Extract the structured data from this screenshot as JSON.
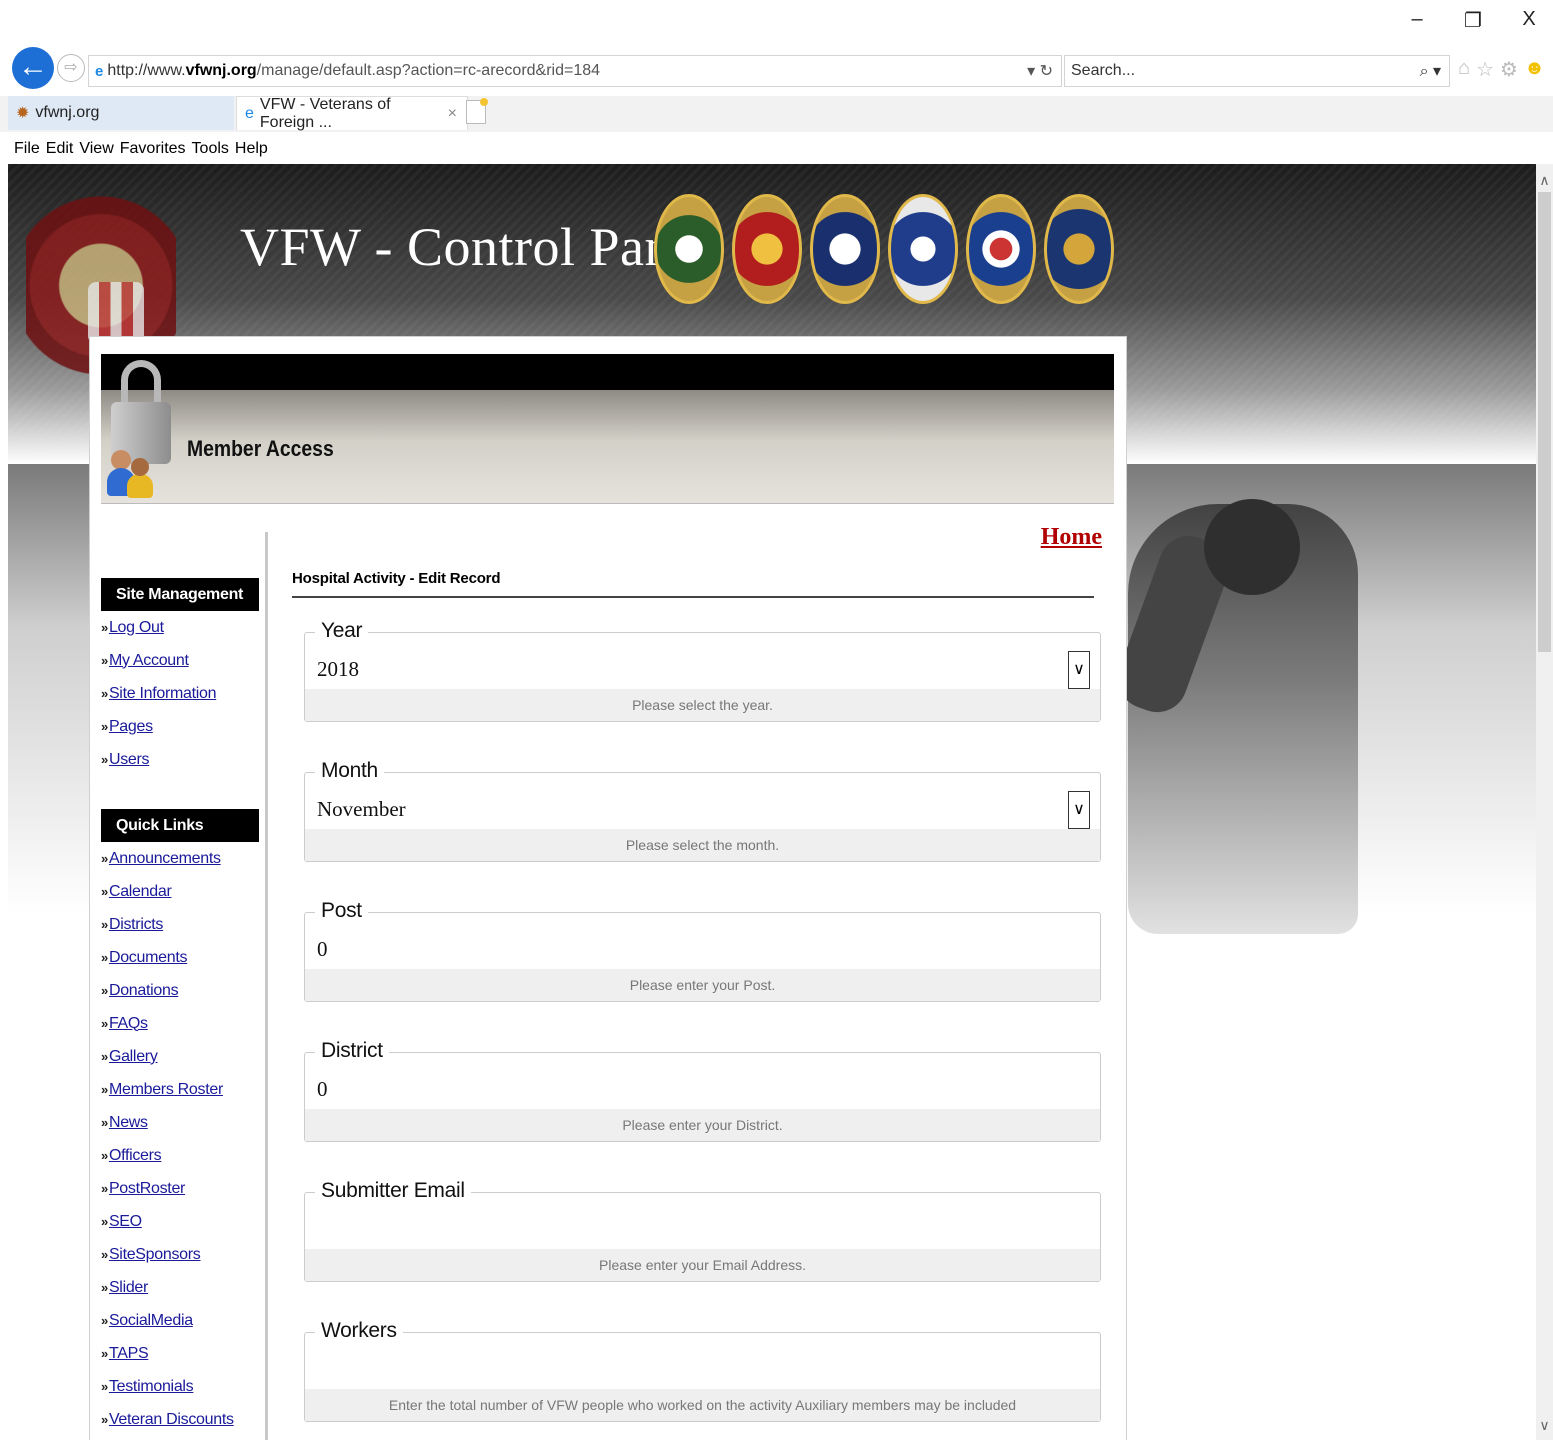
{
  "window": {
    "minimize": "–",
    "restore": "❐",
    "close": "X"
  },
  "browser": {
    "url_domain_prefix": "http://www.",
    "url_domain": "vfwnj.org",
    "url_path": "/manage/default.asp?action=rc-arecord&rid=184",
    "search_placeholder": "Search...",
    "tabs": [
      {
        "label": "vfwnj.org"
      },
      {
        "label": "VFW - Veterans of Foreign ..."
      }
    ],
    "menu": [
      "File",
      "Edit",
      "View",
      "Favorites",
      "Tools",
      "Help"
    ]
  },
  "banner": {
    "title": "VFW - Control Panel"
  },
  "panel": {
    "header_title": "Member Access"
  },
  "sidebar": {
    "site_management": {
      "title": "Site Management",
      "items": [
        "Log Out",
        "My Account",
        "Site Information",
        "Pages",
        "Users"
      ]
    },
    "quick_links": {
      "title": "Quick Links",
      "items": [
        "Announcements",
        "Calendar",
        "Districts",
        "Documents",
        "Donations",
        "FAQs",
        "Gallery",
        "Members Roster",
        "News",
        "Officers",
        "PostRoster",
        "SEO",
        "SiteSponsors",
        "Slider",
        "SocialMedia",
        "TAPS",
        "Testimonials",
        "Veteran Discounts"
      ]
    }
  },
  "content": {
    "home_link": "Home",
    "heading": "Hospital Activity - Edit Record",
    "fields": [
      {
        "legend": "Year",
        "value": "2018",
        "hint": "Please select the year.",
        "type": "select"
      },
      {
        "legend": "Month",
        "value": "November",
        "hint": "Please select the month.",
        "type": "select"
      },
      {
        "legend": "Post",
        "value": "0",
        "hint": "Please enter your Post.",
        "type": "text"
      },
      {
        "legend": "District",
        "value": "0",
        "hint": "Please enter your District.",
        "type": "text"
      },
      {
        "legend": "Submitter Email",
        "value": "",
        "hint": "Please enter your Email Address.",
        "type": "text"
      },
      {
        "legend": "Workers",
        "value": "",
        "hint": "Enter the total number of VFW people who worked on the activity Auxiliary members may be included",
        "type": "text"
      }
    ]
  }
}
